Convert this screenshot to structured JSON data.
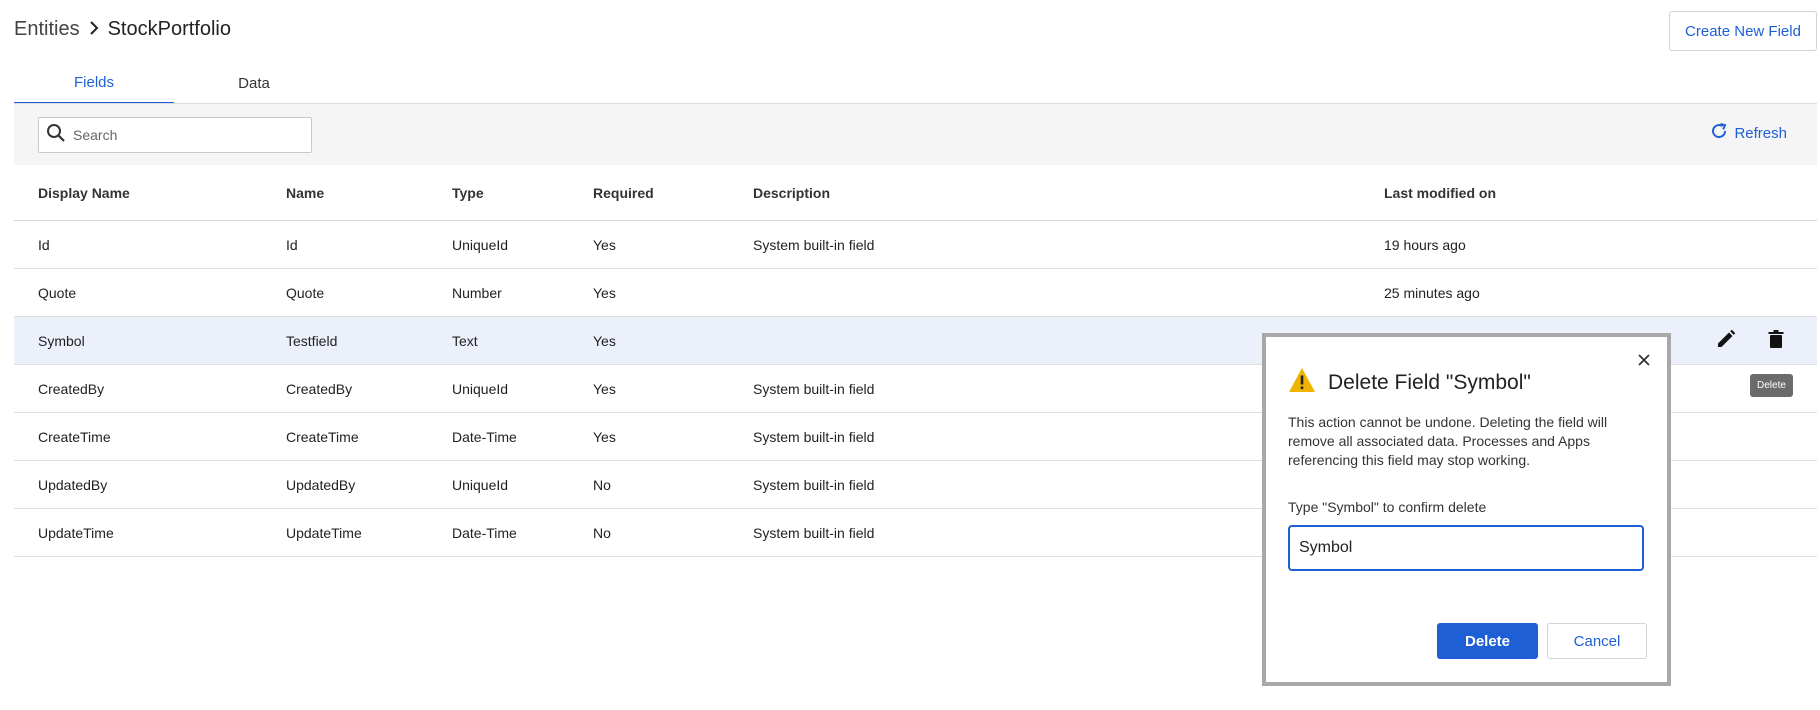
{
  "header": {
    "breadcrumb_root": "Entities",
    "breadcrumb_current": "StockPortfolio",
    "create_button": "Create New Field"
  },
  "tabs": [
    {
      "label": "Fields",
      "active": true
    },
    {
      "label": "Data",
      "active": false
    }
  ],
  "toolbar": {
    "search_placeholder": "Search",
    "refresh_label": "Refresh"
  },
  "table": {
    "columns": [
      "Display Name",
      "Name",
      "Type",
      "Required",
      "Description",
      "Last modified on"
    ],
    "rows": [
      {
        "display_name": "Id",
        "name": "Id",
        "type": "UniqueId",
        "required": "Yes",
        "description": "System built-in field",
        "last_modified": "19 hours ago"
      },
      {
        "display_name": "Quote",
        "name": "Quote",
        "type": "Number",
        "required": "Yes",
        "description": "",
        "last_modified": "25 minutes ago"
      },
      {
        "display_name": "Symbol",
        "name": "Testfield",
        "type": "Text",
        "required": "Yes",
        "description": "",
        "last_modified": ""
      },
      {
        "display_name": "CreatedBy",
        "name": "CreatedBy",
        "type": "UniqueId",
        "required": "Yes",
        "description": "System built-in field",
        "last_modified": ""
      },
      {
        "display_name": "CreateTime",
        "name": "CreateTime",
        "type": "Date-Time",
        "required": "Yes",
        "description": "System built-in field",
        "last_modified": ""
      },
      {
        "display_name": "UpdatedBy",
        "name": "UpdatedBy",
        "type": "UniqueId",
        "required": "No",
        "description": "System built-in field",
        "last_modified": ""
      },
      {
        "display_name": "UpdateTime",
        "name": "UpdateTime",
        "type": "Date-Time",
        "required": "No",
        "description": "System built-in field",
        "last_modified": ""
      }
    ]
  },
  "tooltip": "Delete",
  "dialog": {
    "title": "Delete Field \"Symbol\"",
    "message": "This action cannot be undone. Deleting the field will remove all associated data. Processes and Apps referencing this field may stop working.",
    "confirm_label": "Type \"Symbol\" to confirm delete",
    "confirm_value": "Symbol",
    "delete_button": "Delete",
    "cancel_button": "Cancel"
  },
  "colors": {
    "accent": "#1f5fd6",
    "warning": "#f0b400",
    "selected_row": "#ebf0fa"
  },
  "icons": [
    "search-icon",
    "refresh-icon",
    "edit-icon",
    "trash-icon",
    "close-icon",
    "warning-icon",
    "chevron-right-icon"
  ]
}
